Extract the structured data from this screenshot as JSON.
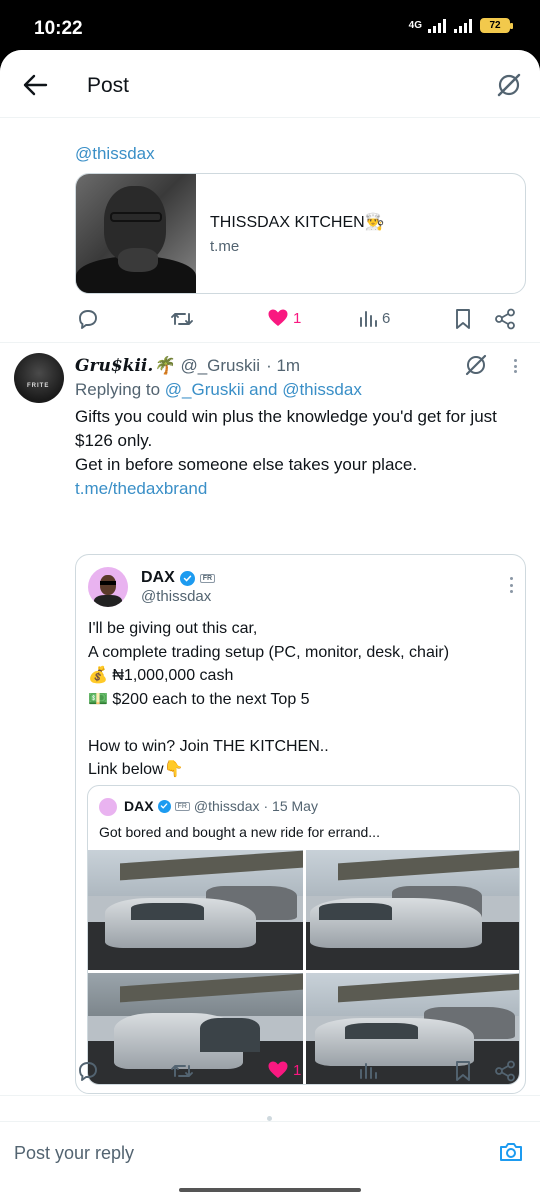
{
  "status_bar": {
    "time": "10:22",
    "network": "4G",
    "battery": "72"
  },
  "header": {
    "title": "Post"
  },
  "top_post": {
    "mention": "@thissdax",
    "link_card": {
      "title": "THISSDAX KITCHEN👨‍🍳",
      "domain": "t.me"
    },
    "actions": {
      "likes": "1",
      "views": "6"
    }
  },
  "reply": {
    "name": "Gru$kii.🌴",
    "handle": "@_Gruskii",
    "time": "· 1m",
    "replying_prefix": "Replying to ",
    "replying_to": "@_Gruskii and @thissdax",
    "lines": [
      "Gifts you could win plus the knowledge you'd get for just $126 only.",
      "Get in before someone else takes your place."
    ],
    "link": "t.me/thedaxbrand",
    "avatar_text": "FRITE",
    "actions": {
      "likes": "1"
    }
  },
  "quote": {
    "name": "DAX",
    "badge": "FR",
    "handle": "@thissdax",
    "lines": [
      "I'll be giving out this car,",
      "A complete trading setup (PC, monitor, desk, chair)",
      "💰 ₦1,000,000 cash",
      "💵 $200 each to the next Top 5",
      "",
      "How to win? Join THE KITCHEN..",
      "Link below👇"
    ],
    "nested": {
      "name": "DAX",
      "handle": "@thissdax",
      "date": "· 15 May",
      "text": "Got bored and bought a new ride for errand..."
    }
  },
  "composer": {
    "placeholder": "Post your reply"
  }
}
